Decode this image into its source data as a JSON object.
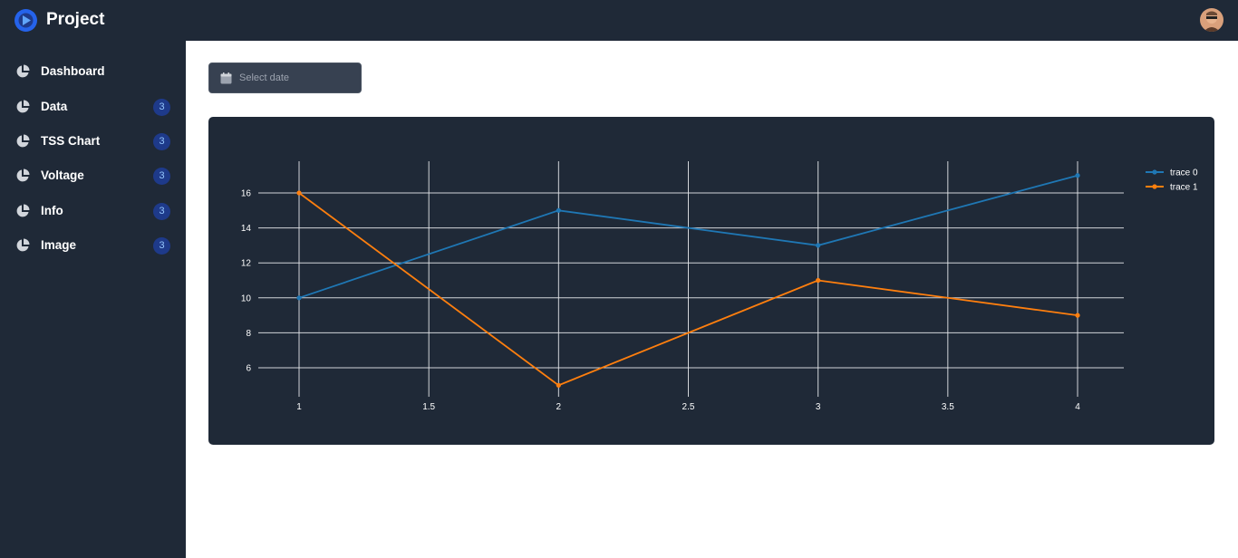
{
  "header": {
    "title": "Project",
    "logo_icon": "logo-icon",
    "avatar_icon": "user-avatar"
  },
  "sidebar": {
    "items": [
      {
        "label": "Dashboard",
        "icon": "pie-chart-icon",
        "badge": ""
      },
      {
        "label": "Data",
        "icon": "pie-chart-icon",
        "badge": "3"
      },
      {
        "label": "TSS Chart",
        "icon": "pie-chart-icon",
        "badge": "3"
      },
      {
        "label": "Voltage",
        "icon": "pie-chart-icon",
        "badge": "3"
      },
      {
        "label": "Info",
        "icon": "pie-chart-icon",
        "badge": "3"
      },
      {
        "label": "Image",
        "icon": "pie-chart-icon",
        "badge": "3"
      }
    ]
  },
  "date_picker": {
    "placeholder": "Select date",
    "icon": "calendar-icon"
  },
  "colors": {
    "bg_dark": "#1f2937",
    "trace0": "#1f77b4",
    "trace1": "#ff7f0e",
    "badge_bg": "#1e3a8a"
  },
  "chart_data": {
    "type": "line",
    "x_ticks": [
      "1",
      "1.5",
      "2",
      "2.5",
      "3",
      "3.5",
      "4"
    ],
    "y_ticks": [
      "6",
      "8",
      "10",
      "12",
      "14",
      "16"
    ],
    "xlim": [
      1,
      4
    ],
    "ylim": [
      4,
      18
    ],
    "grid": true,
    "legend": "top-right",
    "series": [
      {
        "name": "trace 0",
        "x": [
          1,
          2,
          3,
          4
        ],
        "y": [
          10,
          15,
          13,
          17
        ],
        "color": "#1f77b4"
      },
      {
        "name": "trace 1",
        "x": [
          1,
          2,
          3,
          4
        ],
        "y": [
          16,
          5,
          11,
          9
        ],
        "color": "#ff7f0e"
      }
    ]
  }
}
